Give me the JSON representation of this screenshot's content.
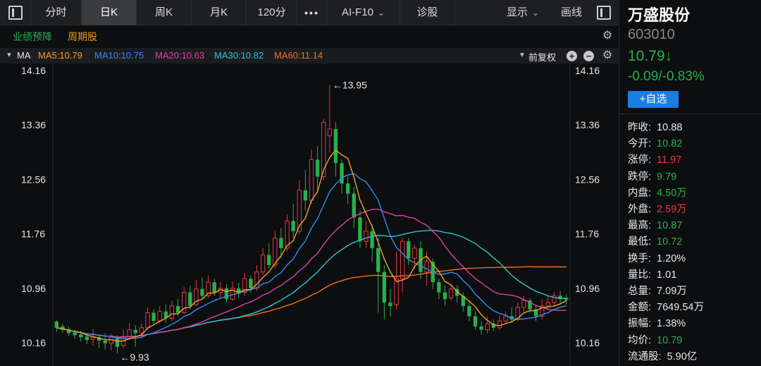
{
  "toolbar": {
    "tabs": [
      "分时",
      "日K",
      "周K",
      "月K",
      "120分"
    ],
    "more": "•••",
    "ai": "AI-F10",
    "diagnose": "诊股",
    "display": "显示",
    "draw": "画线"
  },
  "subbar": {
    "tag_forecast": "业绩预降",
    "tag_cycle": "周期股"
  },
  "ma_bar": {
    "label": "MA",
    "ma5": "MA5:10.79",
    "ma10": "MA10:10.75",
    "ma20": "MA20:10.63",
    "ma30": "MA30:10.82",
    "ma60": "MA60:11.14",
    "adjust": "前复权"
  },
  "chart_data": {
    "type": "candlestick",
    "y_ticks": [
      "14.16",
      "13.36",
      "12.56",
      "11.76",
      "10.96",
      "10.16"
    ],
    "ylim": [
      10.16,
      14.16
    ],
    "high_marker": "13.95",
    "low_marker": "9.93",
    "colors": {
      "up": "#e8383d",
      "down": "#27b14a",
      "ma5": "#f0a030",
      "ma10": "#2f8ff0",
      "ma20": "#e040a8",
      "ma30": "#29c5d6",
      "ma60": "#f07020"
    },
    "candles": [
      [
        10.47,
        10.38,
        10.49,
        10.32
      ],
      [
        10.4,
        10.35,
        10.44,
        10.3
      ],
      [
        10.36,
        10.3,
        10.4,
        10.26
      ],
      [
        10.31,
        10.27,
        10.35,
        10.22
      ],
      [
        10.28,
        10.24,
        10.33,
        10.18
      ],
      [
        10.25,
        10.2,
        10.3,
        10.14
      ],
      [
        10.21,
        10.24,
        10.36,
        10.12
      ],
      [
        10.24,
        10.19,
        10.28,
        10.08
      ],
      [
        10.19,
        10.15,
        10.3,
        10.06
      ],
      [
        10.15,
        10.24,
        10.29,
        10.05
      ],
      [
        10.23,
        10.1,
        10.27,
        10.0
      ],
      [
        10.12,
        10.25,
        10.35,
        10.08
      ],
      [
        10.25,
        10.35,
        10.45,
        10.2
      ],
      [
        10.35,
        10.3,
        10.42,
        10.1
      ],
      [
        10.3,
        10.38,
        10.44,
        10.25
      ],
      [
        10.38,
        10.6,
        10.68,
        10.35
      ],
      [
        10.6,
        10.48,
        10.65,
        10.42
      ],
      [
        10.48,
        10.62,
        10.7,
        10.45
      ],
      [
        10.62,
        10.52,
        10.72,
        10.45
      ],
      [
        10.52,
        10.7,
        10.78,
        10.48
      ],
      [
        10.7,
        10.6,
        10.8,
        10.55
      ],
      [
        10.6,
        10.9,
        10.98,
        10.58
      ],
      [
        10.9,
        10.7,
        11.0,
        10.65
      ],
      [
        10.72,
        10.95,
        11.08,
        10.7
      ],
      [
        10.95,
        10.85,
        11.12,
        10.8
      ],
      [
        10.85,
        11.05,
        11.15,
        10.82
      ],
      [
        11.05,
        10.9,
        11.1,
        10.85
      ],
      [
        10.9,
        10.96,
        11.05,
        10.82
      ],
      [
        10.96,
        10.8,
        11.02,
        10.75
      ],
      [
        10.8,
        10.96,
        11.06,
        10.78
      ],
      [
        10.96,
        10.88,
        11.04,
        10.82
      ],
      [
        10.9,
        11.1,
        11.18,
        10.85
      ],
      [
        11.1,
        10.96,
        11.15,
        10.9
      ],
      [
        10.96,
        11.2,
        11.3,
        10.92
      ],
      [
        11.2,
        11.45,
        11.55,
        11.15
      ],
      [
        11.45,
        11.3,
        11.62,
        11.25
      ],
      [
        11.3,
        11.7,
        11.8,
        11.25
      ],
      [
        11.7,
        11.55,
        11.85,
        11.4
      ],
      [
        11.55,
        11.95,
        12.05,
        11.5
      ],
      [
        11.95,
        11.8,
        12.2,
        11.7
      ],
      [
        11.8,
        12.4,
        12.55,
        11.75
      ],
      [
        12.4,
        12.25,
        12.7,
        12.1
      ],
      [
        12.25,
        12.85,
        13.0,
        12.2
      ],
      [
        12.85,
        12.6,
        13.05,
        12.4
      ],
      [
        12.6,
        13.4,
        13.45,
        12.55
      ],
      [
        13.2,
        13.3,
        13.95,
        12.95
      ],
      [
        13.3,
        12.8,
        13.4,
        12.6
      ],
      [
        12.8,
        12.5,
        12.85,
        12.35
      ],
      [
        12.5,
        12.35,
        12.6,
        12.2
      ],
      [
        12.35,
        12.0,
        12.45,
        11.85
      ],
      [
        12.0,
        11.65,
        12.1,
        11.55
      ],
      [
        11.65,
        11.8,
        11.95,
        11.55
      ],
      [
        11.8,
        11.55,
        11.9,
        11.35
      ],
      [
        11.55,
        11.2,
        11.7,
        10.6
      ],
      [
        11.2,
        10.75,
        11.3,
        10.5
      ],
      [
        10.75,
        10.7,
        10.95,
        10.55
      ],
      [
        10.72,
        11.1,
        11.5,
        10.65
      ],
      [
        11.1,
        11.65,
        11.7,
        10.9
      ],
      [
        11.65,
        11.4,
        11.7,
        11.3
      ],
      [
        11.4,
        11.55,
        11.6,
        11.25
      ],
      [
        11.55,
        11.2,
        11.65,
        11.1
      ],
      [
        11.2,
        11.35,
        11.5,
        11.0
      ],
      [
        11.35,
        11.05,
        11.4,
        10.95
      ],
      [
        11.05,
        10.9,
        11.1,
        10.8
      ],
      [
        10.9,
        10.8,
        11.0,
        10.7
      ],
      [
        10.82,
        10.95,
        11.02,
        10.78
      ],
      [
        10.95,
        10.85,
        11.0,
        10.75
      ],
      [
        10.85,
        10.7,
        10.9,
        10.62
      ],
      [
        10.7,
        10.55,
        10.78,
        10.48
      ],
      [
        10.55,
        10.4,
        10.62,
        10.35
      ],
      [
        10.4,
        10.35,
        10.48,
        10.28
      ],
      [
        10.35,
        10.44,
        10.55,
        10.3
      ],
      [
        10.44,
        10.38,
        10.5,
        10.33
      ],
      [
        10.38,
        10.48,
        10.56,
        10.35
      ],
      [
        10.48,
        10.55,
        10.62,
        10.45
      ],
      [
        10.55,
        10.5,
        10.68,
        10.45
      ],
      [
        10.5,
        10.68,
        10.75,
        10.48
      ],
      [
        10.68,
        10.78,
        10.85,
        10.6
      ],
      [
        10.78,
        10.65,
        10.82,
        10.6
      ],
      [
        10.65,
        10.55,
        10.72,
        10.48
      ],
      [
        10.55,
        10.7,
        10.8,
        10.5
      ],
      [
        10.7,
        10.75,
        10.85,
        10.65
      ],
      [
        10.75,
        10.85,
        10.9,
        10.7
      ],
      [
        10.85,
        10.8,
        10.92,
        10.72
      ],
      [
        10.82,
        10.79,
        10.87,
        10.72
      ]
    ]
  },
  "panel": {
    "name": "万盛股份",
    "code": "603010",
    "price": "10.79↓",
    "change": "-0.09/-0.83%",
    "watch": "+自选",
    "quotes": [
      {
        "label": "昨收:",
        "value": "10.88",
        "color": "#e8e8e8"
      },
      {
        "label": "今开:",
        "value": "10.82",
        "color": "#27b14a"
      },
      {
        "label": "涨停:",
        "value": "11.97",
        "color": "#e8383d"
      },
      {
        "label": "跌停:",
        "value": "9.79",
        "color": "#27b14a"
      },
      {
        "label": "内盘:",
        "value": "4.50万",
        "color": "#27b14a"
      },
      {
        "label": "外盘:",
        "value": "2.59万",
        "color": "#e8383d"
      },
      {
        "label": "最高:",
        "value": "10.87",
        "color": "#27b14a"
      },
      {
        "label": "最低:",
        "value": "10.72",
        "color": "#27b14a"
      },
      {
        "label": "换手:",
        "value": "1.20%",
        "color": "#e8e8e8"
      },
      {
        "label": "量比:",
        "value": "1.01",
        "color": "#e8e8e8"
      },
      {
        "label": "总量:",
        "value": "7.09万",
        "color": "#e8e8e8"
      },
      {
        "label": "金额:",
        "value": "7649.54万",
        "color": "#e8e8e8"
      },
      {
        "label": "振幅:",
        "value": "1.38%",
        "color": "#e8e8e8"
      },
      {
        "label": "均价:",
        "value": "10.79",
        "color": "#27b14a"
      },
      {
        "label": "流通股:",
        "value": "5.90亿",
        "color": "#e8e8e8"
      }
    ]
  }
}
